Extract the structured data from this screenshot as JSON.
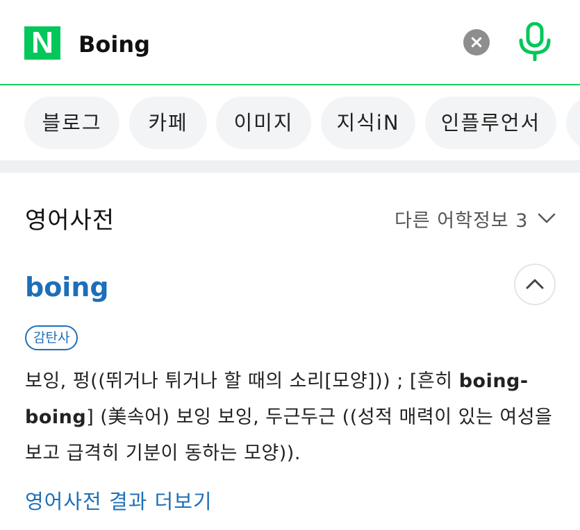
{
  "header": {
    "logo_letter": "N",
    "search_query": "Boing",
    "clear_icon": "close-icon",
    "mic_icon": "microphone-icon",
    "accent_color": "#03c75a"
  },
  "tabs": [
    {
      "label": "블로그"
    },
    {
      "label": "카페"
    },
    {
      "label": "이미지"
    },
    {
      "label": "지식iN"
    },
    {
      "label": "인플루언서"
    }
  ],
  "dictionary": {
    "section_title": "영어사전",
    "more_info_label": "다른 어학정보 3",
    "word": "boing",
    "part_of_speech": "감탄사",
    "definition_part1": "보잉, 펑((뛰거나 튀거나 할 때의 소리[모양])) ; [흔히 ",
    "definition_bold": "boing-boing",
    "definition_part2": "] (美속어) 보잉 보잉, 두근두근 ((성적 매력이 있는 여성을 보고 급격히 기분이 동하는 모양)).",
    "more_link": "영어사전 결과 더보기",
    "link_color": "#1d6fb8"
  }
}
